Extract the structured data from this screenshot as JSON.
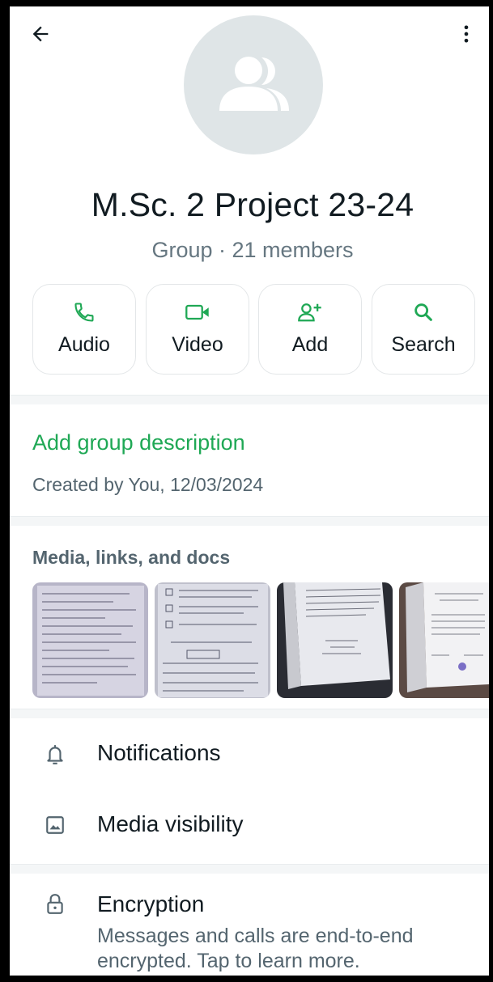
{
  "header": {
    "back_icon": "arrow-left-icon",
    "menu_icon": "more-vertical-icon",
    "avatar_icon": "group-icon"
  },
  "group": {
    "name": "M.Sc. 2 Project 23-24",
    "meta": "Group · 21 members"
  },
  "actions": [
    {
      "label": "Audio",
      "icon": "phone-icon"
    },
    {
      "label": "Video",
      "icon": "video-icon"
    },
    {
      "label": "Add",
      "icon": "add-person-icon"
    },
    {
      "label": "Search",
      "icon": "search-icon"
    }
  ],
  "description": {
    "add_label": "Add group description",
    "created": "Created by You, 12/03/2024"
  },
  "media": {
    "title": "Media, links, and docs",
    "thumbnails": [
      "form-document-1",
      "form-document-2",
      "open-book-page",
      "certificate-page"
    ]
  },
  "settings": {
    "notifications": "Notifications",
    "media_visibility": "Media visibility",
    "encryption": "Encryption",
    "encryption_detail": "Messages and calls are end-to-end encrypted. Tap to learn more."
  },
  "colors": {
    "accent_green": "#1fa855",
    "muted_text": "#667781",
    "avatar_bg": "#dfe5e7"
  }
}
